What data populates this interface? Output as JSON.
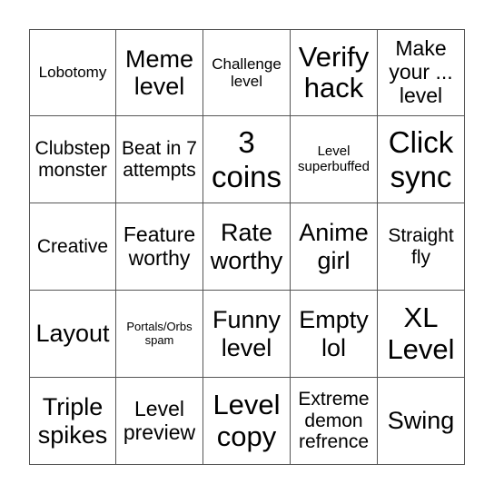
{
  "bingo": {
    "cells": [
      [
        "Lobotomy",
        "Meme level",
        "Challenge level",
        "Verify hack",
        "Make your ... level"
      ],
      [
        "Clubstep monster",
        "Beat in 7 attempts",
        "3 coins",
        "Level superbuffed",
        "Click sync"
      ],
      [
        "Creative",
        "Feature worthy",
        "Rate worthy",
        "Anime girl",
        "Straight fly"
      ],
      [
        "Layout",
        "Portals/Orbs spam",
        "Funny level",
        "Empty lol",
        "XL Level"
      ],
      [
        "Triple spikes",
        "Level preview",
        "Level copy",
        "Extreme demon refrence",
        "Swing"
      ]
    ]
  }
}
